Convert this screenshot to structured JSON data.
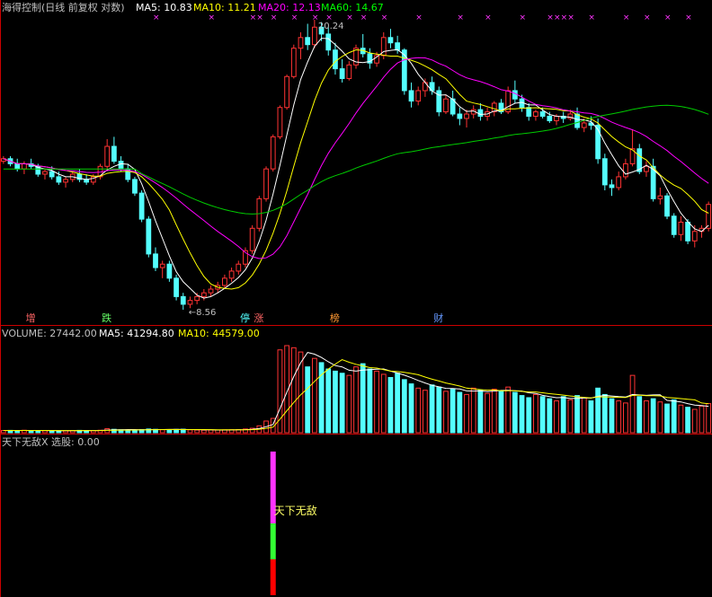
{
  "title_bar": {
    "stock_name": "海得控制(日线 前复权 对数)",
    "ma5": "MA5: 10.83",
    "ma10": "MA10: 11.21",
    "ma20": "MA20: 12.13",
    "ma60": "MA60: 14.67"
  },
  "volume_bar": {
    "label": "VOLUME: 27442.00",
    "ma5": "MA5: 41294.80",
    "ma10": "MA10: 44579.00"
  },
  "indicator_bar": {
    "label": "天下无敌X 选股: 0.00",
    "signal_text": "天下无敌"
  },
  "colors": {
    "up": "#ff3333",
    "down": "#54ffff",
    "ma5": "#ffffff",
    "ma10": "#ffff00",
    "ma20": "#ff00ff",
    "ma60": "#00cc00",
    "marker": "#ff33ff",
    "separator": "#cc0000"
  },
  "chart_data": [
    {
      "type": "candlestick",
      "title": "海得控制(日线 前复权 对数)",
      "scale": "log",
      "price_labels": {
        "high": "20.24",
        "low": "8.56"
      },
      "event_labels": [
        "增",
        "跌",
        "停",
        "涨",
        "榜",
        "财"
      ],
      "ohlc": [
        [
          13.3,
          13.5,
          13.2,
          13.4
        ],
        [
          13.4,
          13.5,
          13.1,
          13.2
        ],
        [
          13.2,
          13.4,
          12.9,
          13.0
        ],
        [
          13.0,
          13.3,
          12.8,
          13.2
        ],
        [
          13.2,
          13.4,
          13.0,
          13.1
        ],
        [
          13.1,
          13.2,
          12.7,
          12.8
        ],
        [
          12.8,
          13.0,
          12.6,
          12.9
        ],
        [
          12.9,
          13.1,
          12.6,
          12.7
        ],
        [
          12.7,
          12.9,
          12.4,
          12.5
        ],
        [
          12.5,
          12.7,
          12.3,
          12.6
        ],
        [
          12.6,
          12.9,
          12.5,
          12.8
        ],
        [
          12.8,
          13.0,
          12.5,
          12.6
        ],
        [
          12.6,
          12.8,
          12.4,
          12.5
        ],
        [
          12.5,
          12.8,
          12.4,
          12.7
        ],
        [
          12.7,
          13.2,
          12.6,
          13.1
        ],
        [
          13.1,
          14.2,
          13.0,
          13.9
        ],
        [
          13.9,
          14.3,
          13.2,
          13.3
        ],
        [
          13.3,
          13.5,
          12.9,
          13.0
        ],
        [
          13.0,
          13.2,
          12.5,
          12.6
        ],
        [
          12.6,
          12.7,
          12.0,
          12.1
        ],
        [
          12.1,
          12.2,
          11.1,
          11.2
        ],
        [
          11.2,
          11.3,
          10.0,
          10.1
        ],
        [
          10.1,
          10.3,
          9.6,
          9.7
        ],
        [
          9.7,
          9.9,
          9.4,
          9.8
        ],
        [
          9.8,
          9.9,
          9.3,
          9.4
        ],
        [
          9.4,
          9.5,
          8.8,
          8.9
        ],
        [
          8.9,
          9.0,
          8.56,
          8.7
        ],
        [
          8.7,
          8.9,
          8.6,
          8.8
        ],
        [
          8.8,
          9.0,
          8.7,
          8.9
        ],
        [
          8.9,
          9.1,
          8.8,
          9.0
        ],
        [
          9.0,
          9.2,
          8.9,
          9.1
        ],
        [
          9.1,
          9.3,
          9.0,
          9.2
        ],
        [
          9.2,
          9.5,
          9.1,
          9.4
        ],
        [
          9.4,
          9.7,
          9.3,
          9.6
        ],
        [
          9.6,
          9.9,
          9.5,
          9.8
        ],
        [
          9.8,
          10.3,
          9.7,
          10.2
        ],
        [
          10.2,
          11.0,
          10.1,
          10.9
        ],
        [
          10.9,
          12.0,
          10.8,
          11.9
        ],
        [
          11.9,
          13.1,
          11.8,
          13.0
        ],
        [
          13.0,
          14.4,
          12.9,
          14.3
        ],
        [
          14.3,
          15.7,
          14.2,
          15.6
        ],
        [
          15.6,
          17.2,
          15.5,
          17.1
        ],
        [
          17.1,
          18.8,
          17.0,
          18.6
        ],
        [
          18.6,
          19.5,
          18.0,
          19.2
        ],
        [
          19.2,
          20.0,
          18.5,
          18.8
        ],
        [
          18.8,
          20.24,
          18.6,
          19.8
        ],
        [
          19.8,
          20.1,
          19.0,
          19.4
        ],
        [
          19.4,
          19.8,
          18.2,
          18.5
        ],
        [
          18.5,
          18.9,
          17.2,
          17.5
        ],
        [
          17.5,
          18.0,
          16.8,
          17.0
        ],
        [
          17.0,
          17.9,
          16.9,
          17.7
        ],
        [
          17.7,
          18.8,
          17.5,
          18.6
        ],
        [
          18.6,
          19.4,
          18.1,
          18.3
        ],
        [
          18.3,
          18.6,
          17.5,
          17.8
        ],
        [
          17.8,
          18.4,
          17.6,
          18.2
        ],
        [
          18.2,
          19.5,
          18.0,
          19.2
        ],
        [
          19.2,
          19.7,
          18.6,
          18.9
        ],
        [
          18.9,
          19.3,
          18.3,
          18.5
        ],
        [
          18.5,
          18.6,
          16.2,
          16.4
        ],
        [
          16.4,
          16.8,
          15.6,
          15.9
        ],
        [
          15.9,
          16.6,
          15.7,
          16.4
        ],
        [
          16.4,
          17.0,
          16.1,
          16.8
        ],
        [
          16.8,
          17.1,
          16.2,
          16.4
        ],
        [
          16.4,
          16.6,
          15.2,
          15.4
        ],
        [
          15.4,
          16.2,
          15.3,
          16.0
        ],
        [
          16.0,
          16.4,
          15.2,
          15.3
        ],
        [
          15.3,
          15.6,
          14.8,
          15.1
        ],
        [
          15.1,
          15.5,
          14.7,
          15.3
        ],
        [
          15.3,
          15.7,
          15.1,
          15.5
        ],
        [
          15.5,
          15.8,
          15.0,
          15.2
        ],
        [
          15.2,
          15.6,
          15.0,
          15.4
        ],
        [
          15.4,
          15.9,
          15.2,
          15.8
        ],
        [
          15.8,
          16.0,
          15.3,
          15.4
        ],
        [
          15.4,
          16.6,
          15.3,
          16.4
        ],
        [
          16.4,
          16.9,
          15.8,
          16.0
        ],
        [
          16.0,
          16.2,
          15.4,
          15.6
        ],
        [
          15.6,
          15.8,
          15.0,
          15.2
        ],
        [
          15.2,
          15.5,
          15.0,
          15.4
        ],
        [
          15.4,
          15.6,
          15.1,
          15.2
        ],
        [
          15.2,
          15.4,
          14.9,
          15.0
        ],
        [
          15.0,
          15.3,
          14.8,
          15.2
        ],
        [
          15.2,
          15.4,
          14.9,
          15.1
        ],
        [
          15.1,
          15.5,
          15.0,
          15.3
        ],
        [
          15.3,
          15.6,
          14.6,
          14.7
        ],
        [
          14.7,
          15.1,
          14.5,
          14.9
        ],
        [
          14.9,
          15.2,
          14.6,
          14.8
        ],
        [
          14.8,
          15.1,
          13.2,
          13.4
        ],
        [
          13.4,
          13.6,
          12.2,
          12.4
        ],
        [
          12.4,
          12.6,
          12.0,
          12.3
        ],
        [
          12.3,
          12.9,
          12.2,
          12.7
        ],
        [
          12.7,
          13.4,
          12.6,
          13.2
        ],
        [
          13.2,
          14.6,
          13.1,
          13.8
        ],
        [
          13.8,
          14.0,
          12.8,
          12.9
        ],
        [
          12.9,
          13.3,
          12.7,
          13.1
        ],
        [
          13.1,
          13.4,
          11.8,
          11.9
        ],
        [
          11.9,
          12.3,
          11.7,
          12.0
        ],
        [
          12.0,
          12.1,
          11.2,
          11.3
        ],
        [
          11.3,
          11.4,
          10.6,
          10.7
        ],
        [
          10.7,
          11.3,
          10.5,
          11.1
        ],
        [
          11.1,
          11.2,
          10.4,
          10.5
        ],
        [
          10.5,
          11.0,
          10.3,
          10.8
        ],
        [
          10.8,
          11.0,
          10.6,
          10.9
        ],
        [
          10.9,
          11.8,
          10.8,
          11.7
        ]
      ],
      "volume": [
        2100,
        2200,
        2000,
        2300,
        2100,
        1900,
        2000,
        2100,
        1800,
        1900,
        2000,
        2200,
        2100,
        2000,
        2300,
        3800,
        3200,
        2800,
        2600,
        2500,
        3000,
        3500,
        3200,
        2800,
        2900,
        3100,
        3300,
        2700,
        2500,
        2400,
        2600,
        2500,
        2700,
        2800,
        3000,
        3500,
        4200,
        6500,
        11000,
        13500,
        78000,
        82000,
        80000,
        76000,
        62000,
        70000,
        66000,
        60000,
        58000,
        56000,
        54000,
        62000,
        65000,
        60000,
        58000,
        55000,
        52000,
        56000,
        50000,
        46000,
        42000,
        40000,
        45000,
        43000,
        39000,
        41000,
        38000,
        36000,
        42000,
        40000,
        37000,
        41000,
        39000,
        43000,
        38000,
        35000,
        33000,
        36000,
        34000,
        32000,
        30000,
        34000,
        31000,
        35000,
        33000,
        30000,
        42000,
        36000,
        32000,
        30000,
        28000,
        54000,
        34000,
        30000,
        32000,
        29000,
        27000,
        31000,
        26000,
        24000,
        22000,
        25000,
        27442
      ],
      "signal_index": 39,
      "signal_segments": [
        {
          "name": "red",
          "from": 0,
          "to": 0.25
        },
        {
          "name": "green",
          "from": 0.25,
          "to": 0.5
        },
        {
          "name": "magenta",
          "from": 0.5,
          "to": 1.0
        }
      ]
    }
  ]
}
